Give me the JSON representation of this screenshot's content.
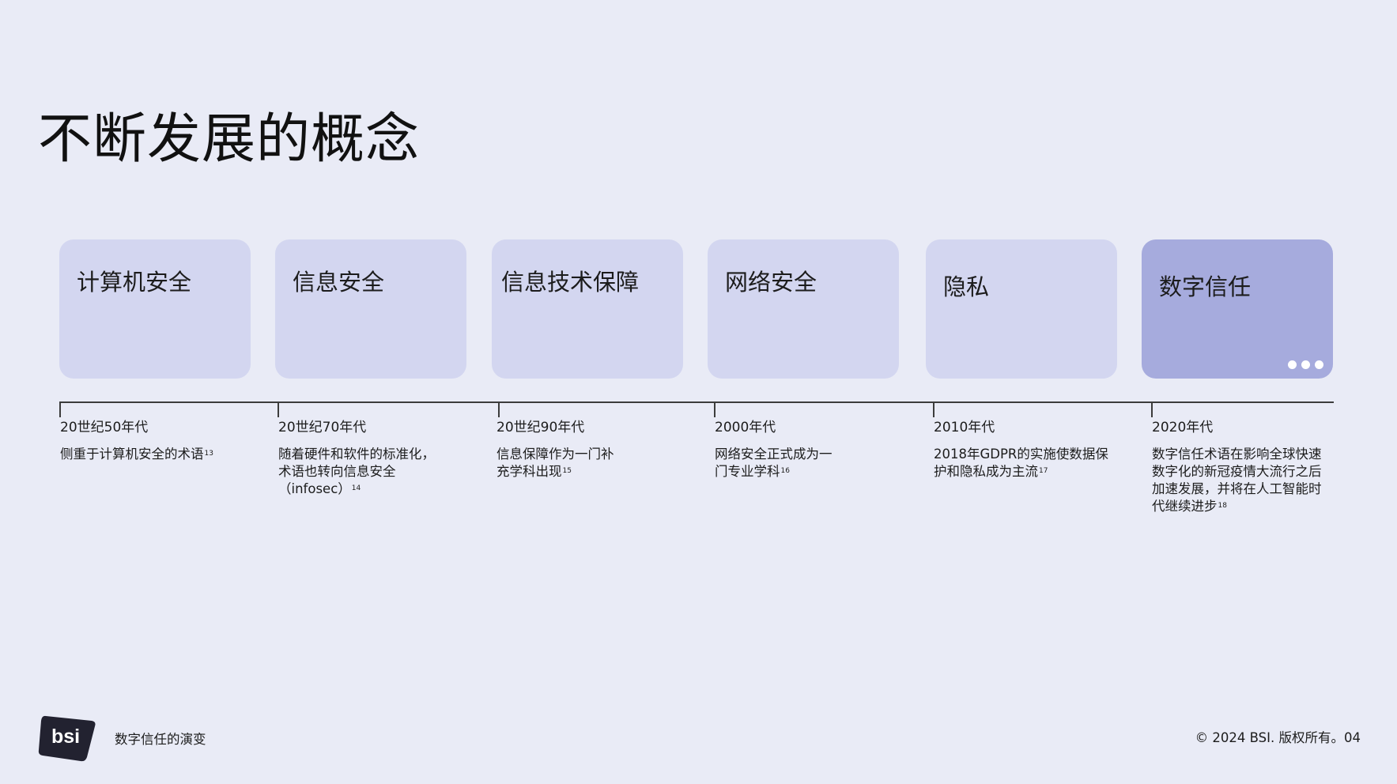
{
  "page": {
    "title": "不断发展的概念"
  },
  "cards": [
    {
      "title": "计算机安全"
    },
    {
      "title": "信息安全"
    },
    {
      "title": "信息技术保障"
    },
    {
      "title": "网络安全"
    },
    {
      "title": "隐私"
    },
    {
      "title": "数字信任",
      "highlight": true,
      "icon": "more-dots-icon"
    }
  ],
  "timeline": [
    {
      "period": "20世纪50年代",
      "description": "侧重于计算机安全的术语",
      "note": "13"
    },
    {
      "period": "20世纪70年代",
      "description": "随着硬件和软件的标准化，术语也转向信息安全（infosec）",
      "note": "14"
    },
    {
      "period": "20世纪90年代",
      "description": "信息保障作为一门补充学科出现",
      "note": "15"
    },
    {
      "period": "2000年代",
      "description": "网络安全正式成为一门专业学科",
      "note": "16"
    },
    {
      "period": "2010年代",
      "description": "2018年GDPR的实施使数据保护和隐私成为主流",
      "note": "17"
    },
    {
      "period": "2020年代",
      "description": "数字信任术语在影响全球快速数字化的新冠疫情大流行之后加速发展，并将在人工智能时代继续进步",
      "note": "18"
    }
  ],
  "footer": {
    "logo_text": "bsi",
    "doc_title": "数字信任的演变",
    "copyright": "© 2024 BSI. 版权所有。04"
  },
  "colors": {
    "background": "#e9ebf6",
    "card": "#d3d6f0",
    "card_highlight": "#a6abdd",
    "logo": "#222230"
  }
}
